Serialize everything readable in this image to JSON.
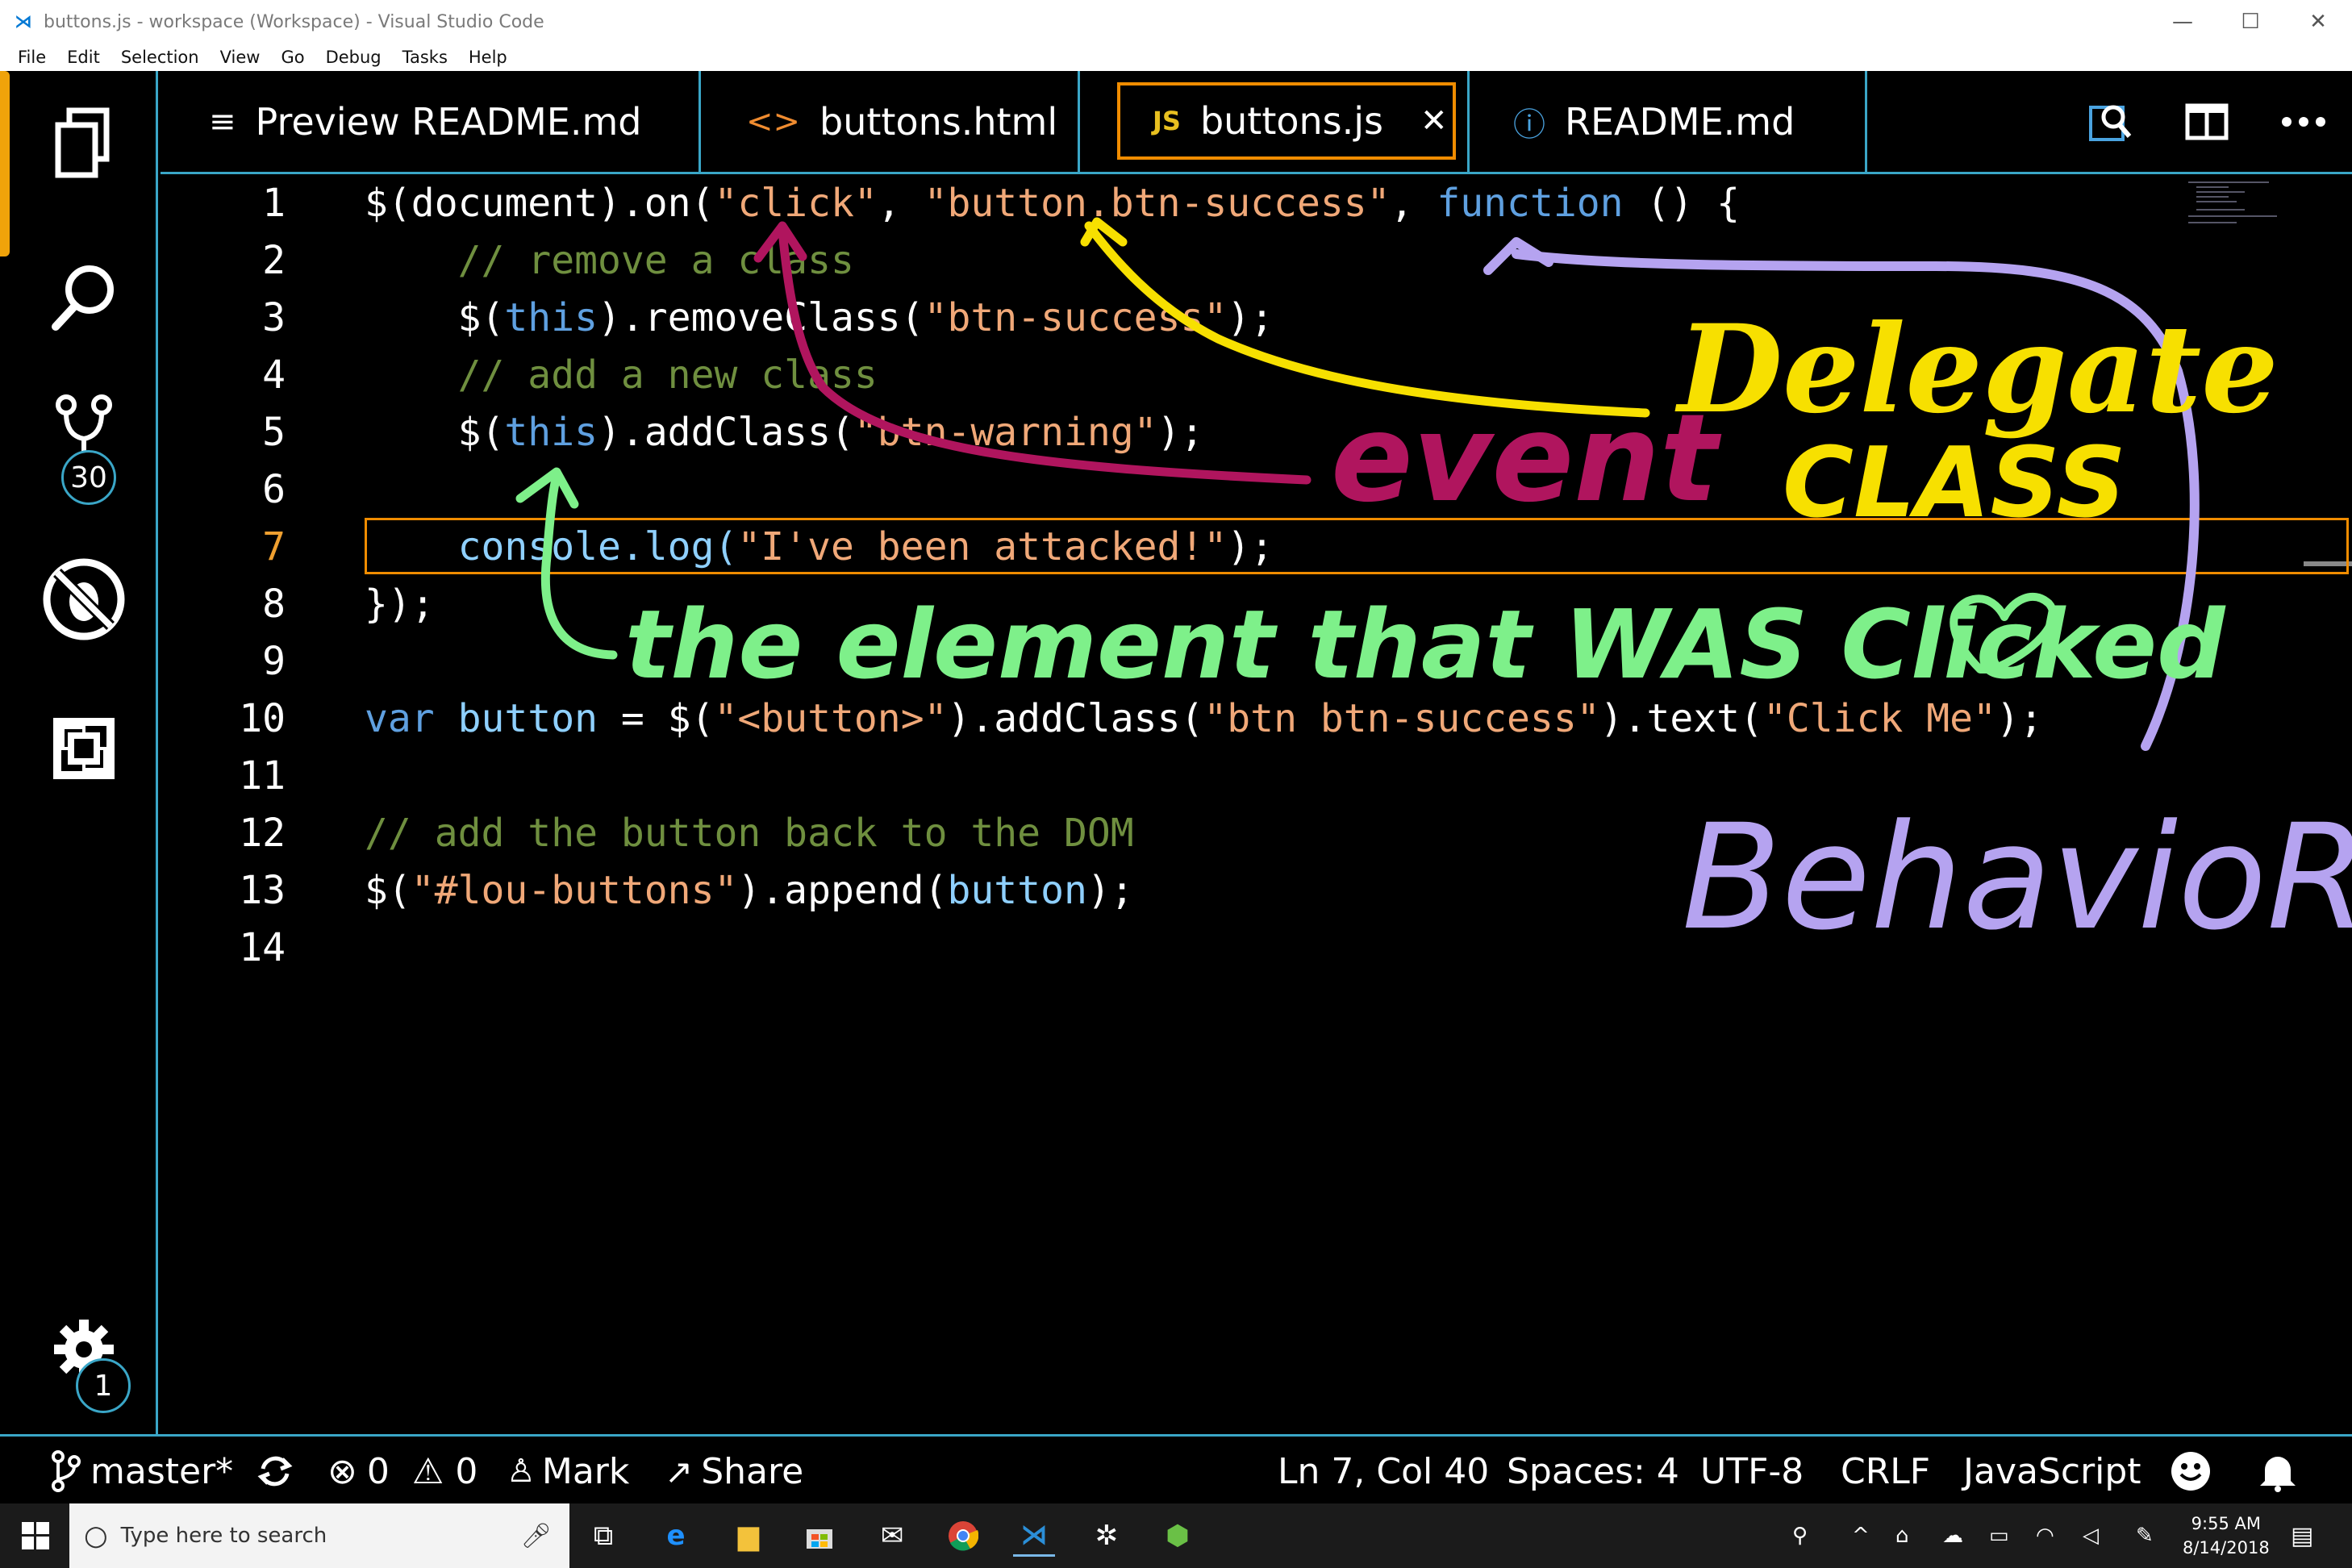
{
  "window": {
    "title": "buttons.js - workspace (Workspace) - Visual Studio Code",
    "controls": [
      "—",
      "☐",
      "✕"
    ]
  },
  "menu": [
    "File",
    "Edit",
    "Selection",
    "View",
    "Go",
    "Debug",
    "Tasks",
    "Help"
  ],
  "activity": {
    "scm_badge": "30",
    "settings_badge": "1"
  },
  "tabs": [
    {
      "label": "Preview README.md",
      "icon": "≡"
    },
    {
      "label": "buttons.html",
      "icon": "<>"
    },
    {
      "label": "buttons.js",
      "icon": "JS",
      "close": "✕"
    },
    {
      "label": "README.md",
      "icon": "ⓘ"
    }
  ],
  "editor": {
    "line_numbers": [
      "1",
      "2",
      "3",
      "4",
      "5",
      "6",
      "7",
      "8",
      "9",
      "10",
      "11",
      "12",
      "13",
      "14"
    ],
    "current_line": "7",
    "lines": {
      "l1a": "$(document).on(",
      "l1b": "\"click\"",
      "l1c": ", ",
      "l1d": "\"button.btn-success\"",
      "l1e": ", ",
      "l1f": "function",
      "l1g": " () {",
      "l2": "    // remove a class",
      "l3a": "    $(",
      "l3b": "this",
      "l3c": ").removeClass(",
      "l3d": "\"btn-success\"",
      "l3e": ");",
      "l4": "    // add a new class",
      "l5a": "    $(",
      "l5b": "this",
      "l5c": ").addClass(",
      "l5d": "\"btn-warning\"",
      "l5e": ");",
      "l7a": "    console.log(",
      "l7b": "\"I've been attacked!\"",
      "l7c": ");",
      "l8": "});",
      "l10a": "var",
      "l10b": " button",
      "l10c": " = $(",
      "l10d": "\"<button>\"",
      "l10e": ").addClass(",
      "l10f": "\"btn btn-success\"",
      "l10g": ").text(",
      "l10h": "\"Click Me\"",
      "l10i": ");",
      "l12": "// add the button back to the DOM",
      "l13a": "$(",
      "l13b": "\"#lou-buttons\"",
      "l13c": ").append(",
      "l13d": "button",
      "l13e": ");"
    }
  },
  "annotations": {
    "delegate": "Delegate",
    "class": "CLASS",
    "event": "event",
    "element": "the element that WAS Clicked",
    "behavior": "BehavioR"
  },
  "status": {
    "branch": "master*",
    "errors": "0",
    "warnings": "0",
    "mark": "Mark",
    "share": "Share",
    "position": "Ln 7, Col 40",
    "spaces": "Spaces: 4",
    "encoding": "UTF-8",
    "eol": "CRLF",
    "language": "JavaScript"
  },
  "taskbar": {
    "search_placeholder": "Type here to search",
    "time": "9:55 AM",
    "date": "8/14/2018"
  },
  "colors": {
    "accent": "#3aa6c7",
    "active_tab": "#f08c00",
    "yellow_ink": "#f7e000",
    "magenta_ink": "#b0155e",
    "green_ink": "#7ef08a",
    "purple_ink": "#b5a3f0"
  }
}
